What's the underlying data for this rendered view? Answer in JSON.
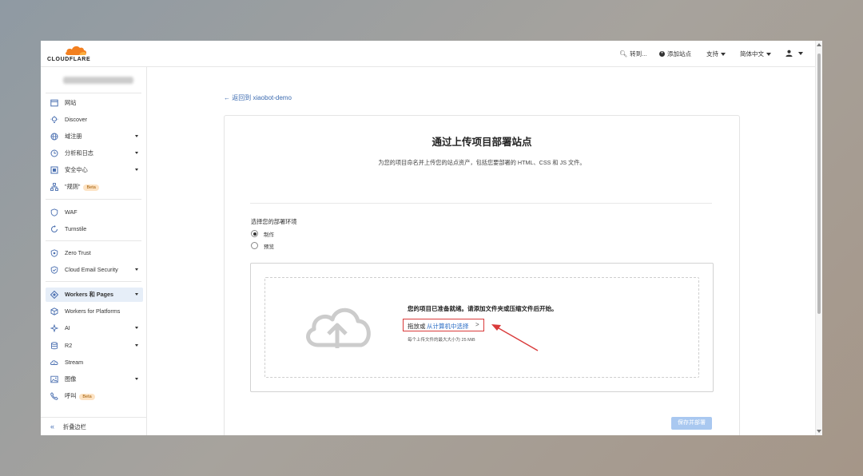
{
  "header": {
    "logo_text": "CLOUDFLARE",
    "goto": "转到...",
    "add_site": "添加站点",
    "support": "支持",
    "language": "简体中文"
  },
  "sidebar": {
    "items": [
      {
        "label": "网站",
        "icon": "browser-icon"
      },
      {
        "label": "Discover",
        "icon": "lightbulb-icon"
      },
      {
        "label": "域注册",
        "icon": "globe-icon"
      },
      {
        "label": "分析和日志",
        "icon": "clock-icon"
      },
      {
        "label": "安全中心",
        "icon": "shield-square-icon"
      },
      {
        "label": "\"规则\"",
        "icon": "sitemap-icon",
        "badge": "Beta"
      },
      {
        "label": "WAF",
        "icon": "waf-icon"
      },
      {
        "label": "Turnstile",
        "icon": "turnstile-icon"
      },
      {
        "label": "Zero Trust",
        "icon": "zero-trust-icon"
      },
      {
        "label": "Cloud Email Security",
        "icon": "email-security-icon"
      },
      {
        "label": "Workers 和 Pages",
        "icon": "workers-icon"
      },
      {
        "label": "Workers for Platforms",
        "icon": "platforms-icon"
      },
      {
        "label": "AI",
        "icon": "ai-icon"
      },
      {
        "label": "R2",
        "icon": "database-icon"
      },
      {
        "label": "Stream",
        "icon": "stream-icon"
      },
      {
        "label": "图像",
        "icon": "image-icon"
      },
      {
        "label": "呼叫",
        "icon": "phone-icon",
        "badge": "Beta"
      }
    ],
    "collapse": "折叠边栏"
  },
  "main": {
    "back_link": "← 返回到 xiaobot-demo",
    "title": "通过上传项目部署站点",
    "description": "为您的项目命名并上传您的站点资产，包括您要部署的 HTML、CSS 和 JS 文件。",
    "env_label": "选择您的部署环境",
    "env_options": [
      "制作",
      "预览"
    ],
    "selected_env": "制作",
    "ready": "您的项目已准备就绪。请添加文件夹或压缩文件后开始。",
    "drag_text": "拖放或",
    "choose_text": "从计算机中选择",
    "max_size": "每个上传文件的最大大小为 25 MiB",
    "save_button": "保存并部署"
  },
  "colors": {
    "accent": "#2c6ec5",
    "highlight_box": "#d93a3a",
    "save_button": "#a9c8f0",
    "active_nav_bg": "#e6eef8"
  }
}
